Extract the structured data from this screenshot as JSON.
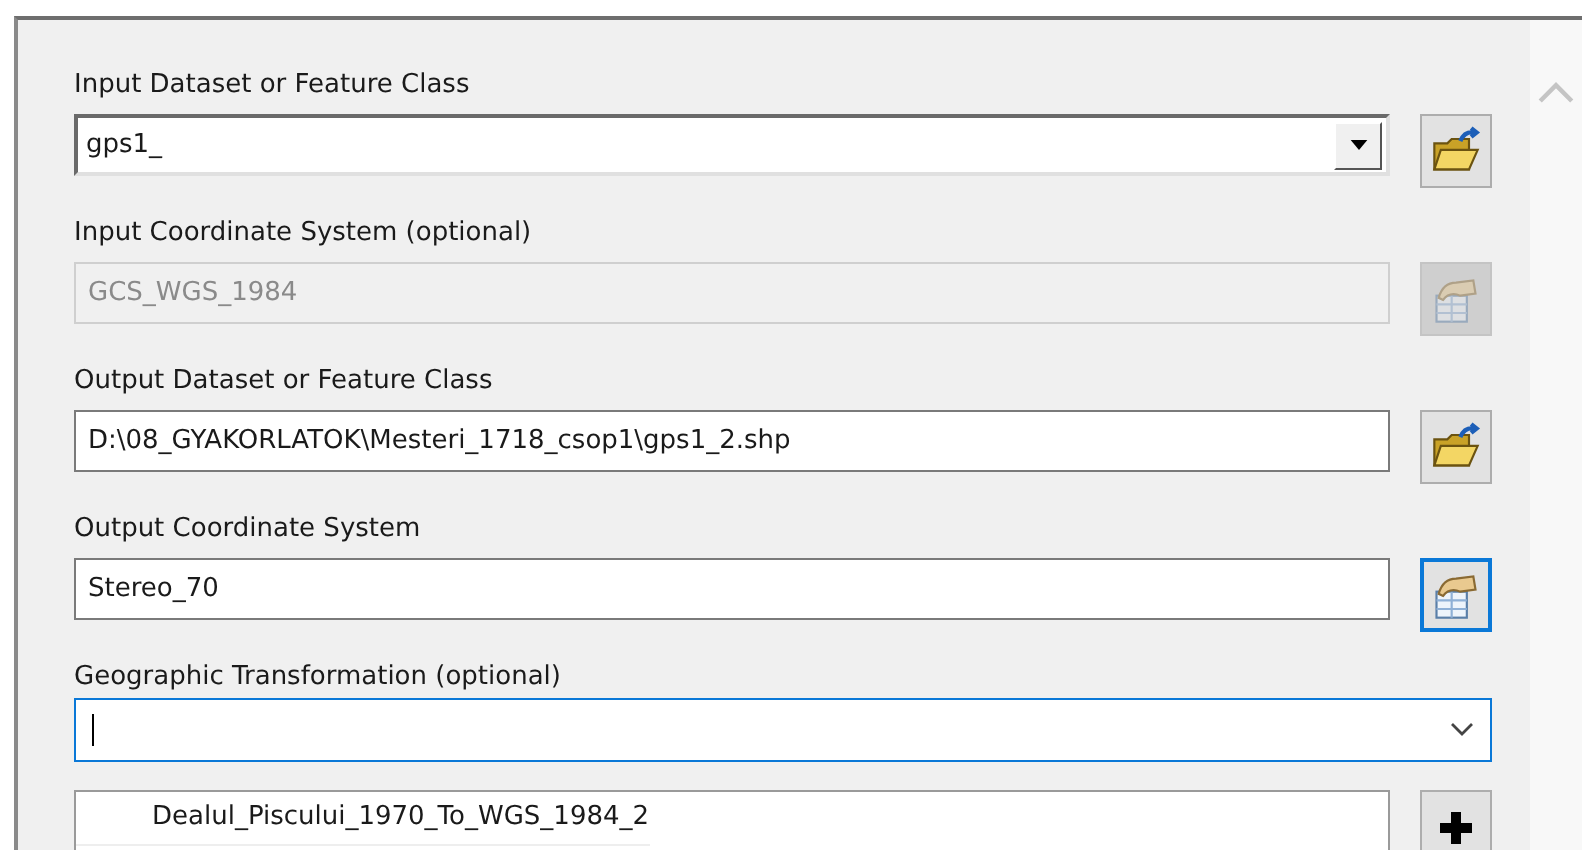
{
  "parameters": [
    {
      "label": "Input Dataset or Feature Class",
      "kind": "combo",
      "value": "gps1_",
      "disabled": false,
      "focused": false,
      "button": {
        "kind": "folder"
      }
    },
    {
      "label": "Input Coordinate System (optional)",
      "kind": "text",
      "value": "GCS_WGS_1984",
      "disabled": true,
      "focused": false,
      "button": {
        "kind": "properties"
      }
    },
    {
      "label": "Output Dataset or Feature Class",
      "kind": "text",
      "value": "D:\\08_GYAKORLATOK\\Mesteri_1718_csop1\\gps1_2.shp",
      "disabled": false,
      "focused": false,
      "button": {
        "kind": "folder"
      }
    },
    {
      "label": "Output Coordinate System",
      "kind": "text",
      "value": "Stereo_70",
      "disabled": false,
      "focused": true,
      "button": {
        "kind": "properties"
      }
    },
    {
      "label": "Geographic Transformation (optional)",
      "kind": "dropdown",
      "disabled": false,
      "focused": true
    }
  ],
  "transformations": [
    {
      "label": "Dealul_Piscului_1970_To_WGS_1984_2"
    }
  ]
}
